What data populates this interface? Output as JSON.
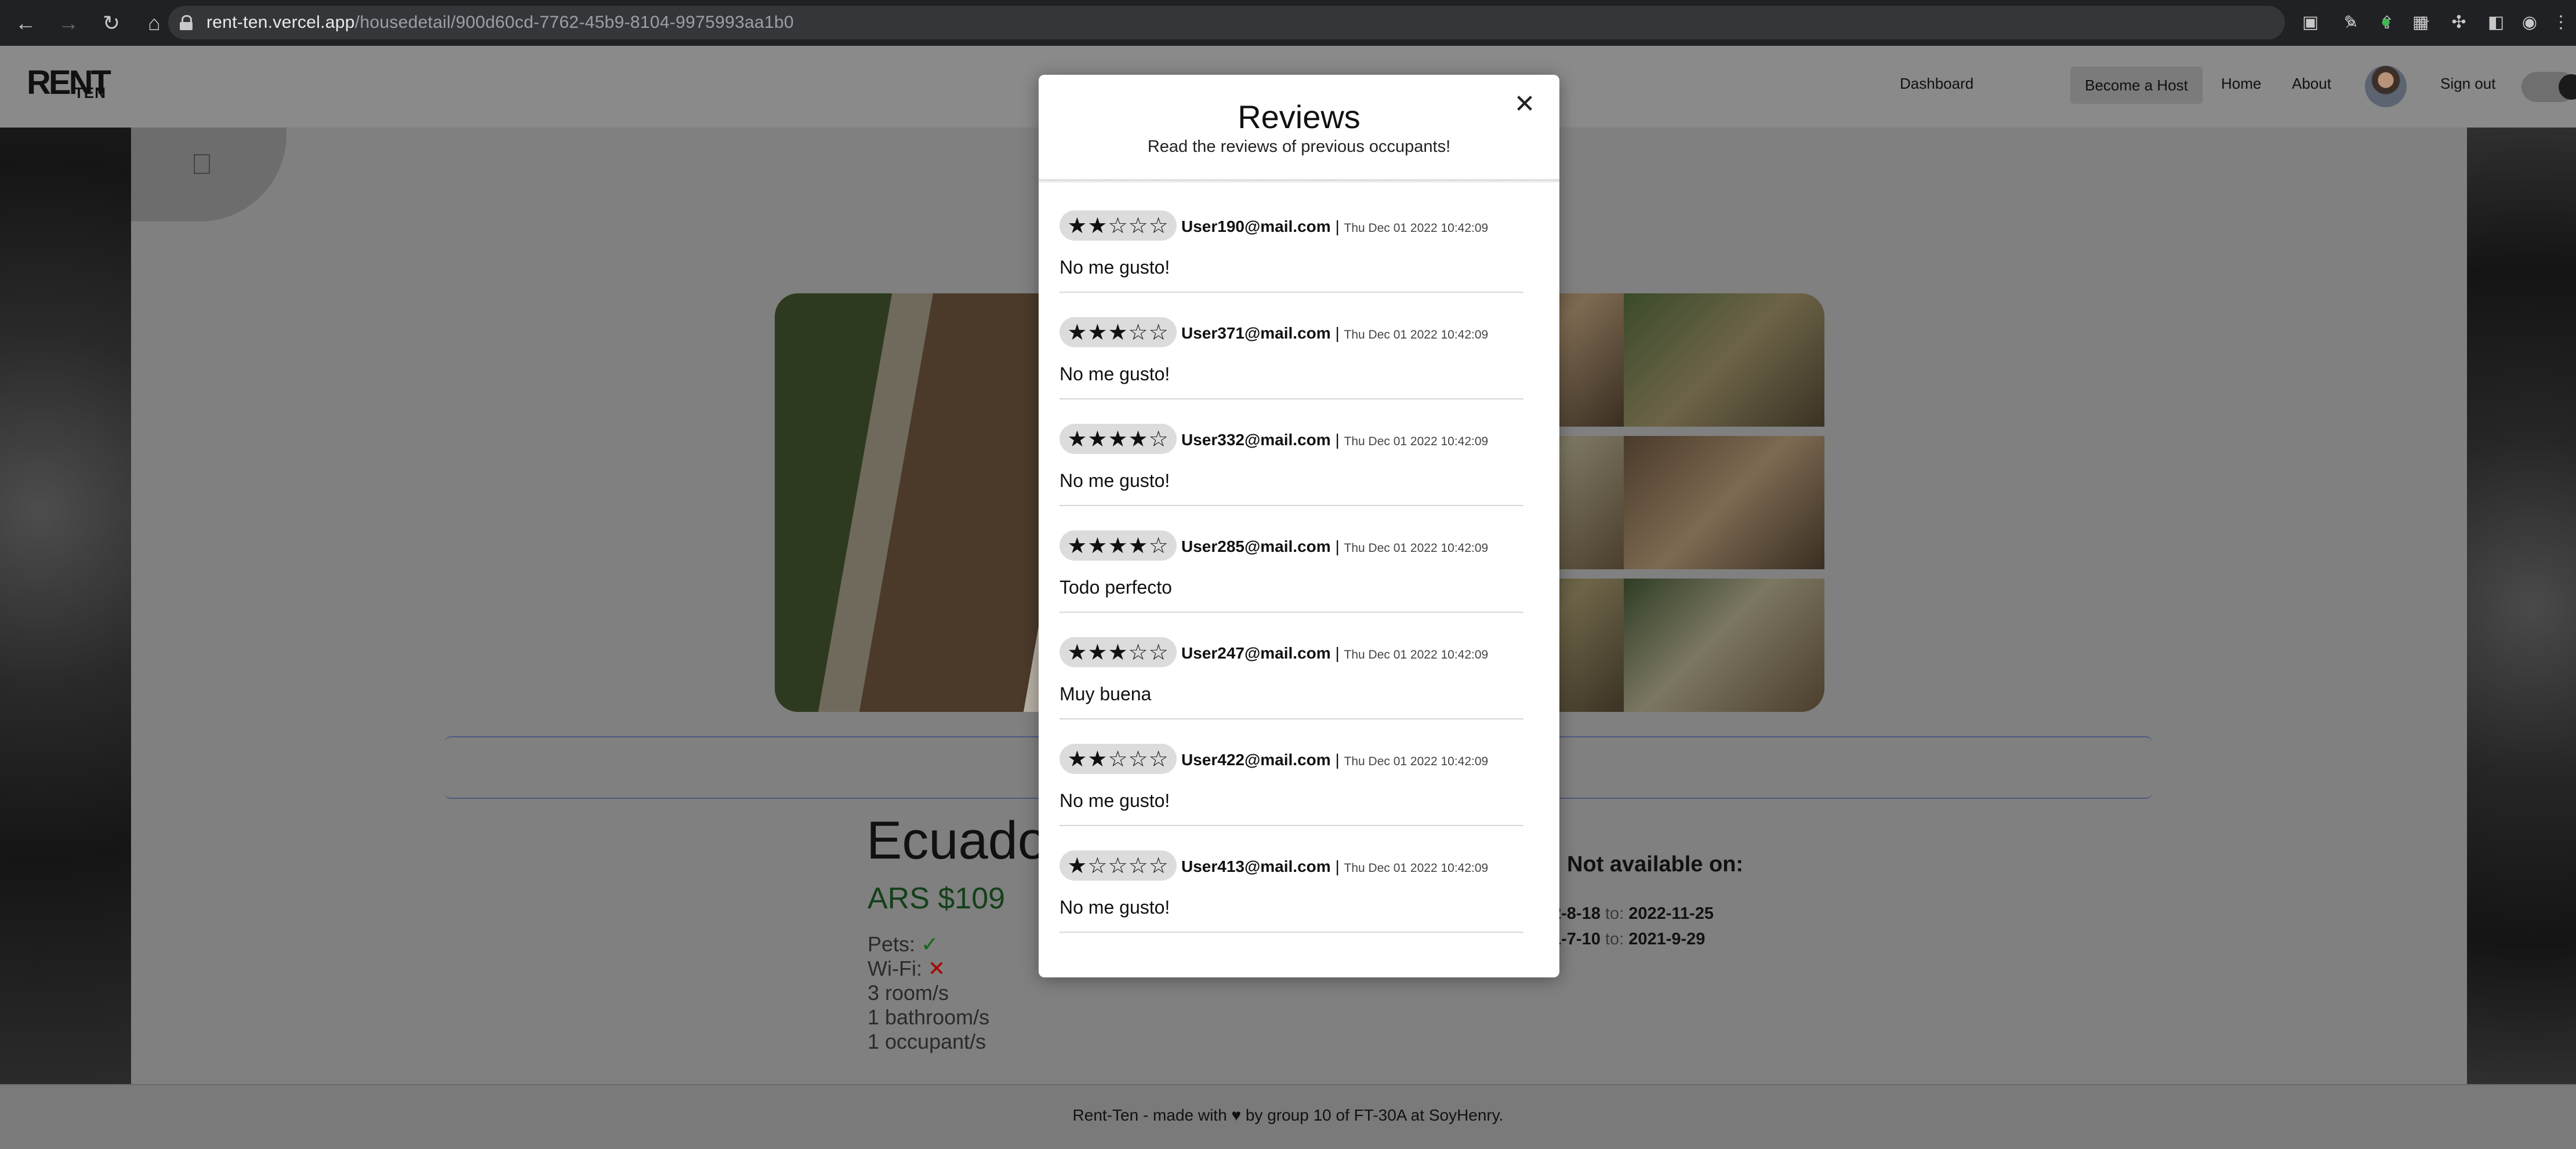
{
  "browser": {
    "url_host": "rent-ten.vercel.app",
    "url_path": "/housedetail/900d60cd-7762-45b9-8104-9975993aa1b0"
  },
  "navbar": {
    "logo_main": "RENT",
    "logo_sub": "TEN",
    "links": {
      "dashboard": "Dashboard",
      "become_host": "Become a Host",
      "home": "Home",
      "about": "About",
      "sign_out": "Sign out"
    }
  },
  "house": {
    "title": "Ecuado",
    "price": "ARS $109",
    "pets_label": "Pets:",
    "pets_value": "✓",
    "wifi_label": "Wi-Fi:",
    "wifi_value": "✕",
    "rooms": "3 room/s",
    "bathrooms": "1 bathroom/s",
    "occupants": "1 occupant/s"
  },
  "availability": {
    "title": "Not available on:",
    "to_label": "to:",
    "ranges": [
      {
        "from": "2-8-18",
        "to": "2022-11-25"
      },
      {
        "from": "1-7-10",
        "to": "2021-9-29"
      }
    ]
  },
  "footer": {
    "before": "Rent-Ten - made with",
    "heart": "♥",
    "after": "by group 10 of FT-30A at SoyHenry."
  },
  "modal": {
    "title": "Reviews",
    "subtitle": "Read the reviews of previous occupants!",
    "close_label": "✕",
    "reviews": [
      {
        "stars": "★★☆☆☆",
        "rating": 2,
        "user": "User190@mail.com",
        "date": "Thu Dec 01 2022 10:42:09",
        "comment": "No me gusto!"
      },
      {
        "stars": "★★★☆☆",
        "rating": 3,
        "user": "User371@mail.com",
        "date": "Thu Dec 01 2022 10:42:09",
        "comment": "No me gusto!"
      },
      {
        "stars": "★★★★☆",
        "rating": 4,
        "user": "User332@mail.com",
        "date": "Thu Dec 01 2022 10:42:09",
        "comment": "No me gusto!"
      },
      {
        "stars": "★★★★☆",
        "rating": 4,
        "user": "User285@mail.com",
        "date": "Thu Dec 01 2022 10:42:09",
        "comment": "Todo perfecto"
      },
      {
        "stars": "★★★☆☆",
        "rating": 3,
        "user": "User247@mail.com",
        "date": "Thu Dec 01 2022 10:42:09",
        "comment": "Muy buena"
      },
      {
        "stars": "★★☆☆☆",
        "rating": 2,
        "user": "User422@mail.com",
        "date": "Thu Dec 01 2022 10:42:09",
        "comment": "No me gusto!"
      },
      {
        "stars": "★☆☆☆☆",
        "rating": 1,
        "user": "User413@mail.com",
        "date": "Thu Dec 01 2022 10:42:09",
        "comment": "No me gusto!"
      }
    ]
  }
}
